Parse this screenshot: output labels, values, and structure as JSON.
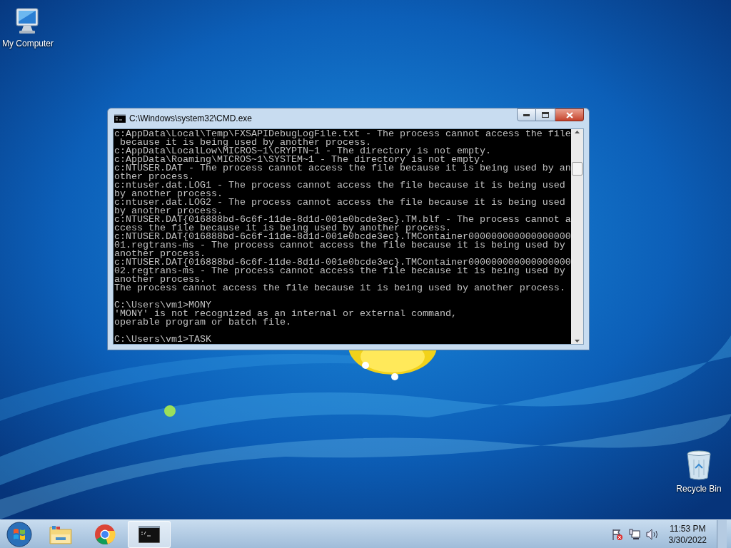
{
  "desktop_icons": [
    {
      "kind": "computer",
      "label": "My Computer"
    },
    {
      "kind": "recycle",
      "label": "Recycle Bin"
    }
  ],
  "window": {
    "title": "C:\\Windows\\system32\\CMD.exe",
    "console_blocks": [
      [
        "c:AppData\\Local\\Temp\\FXSAPIDebugLogFile.txt - The process cannot access the file",
        " because it is being used by another process.",
        "c:AppData\\LocalLow\\MICROS~1\\CRYPTN~1 - The directory is not empty.",
        "c:AppData\\Roaming\\MICROS~1\\SYSTEM~1 - The directory is not empty.",
        "c:NTUSER.DAT - The process cannot access the file because it is being used by an",
        "other process.",
        "c:ntuser.dat.LOG1 - The process cannot access the file because it is being used",
        "by another process.",
        "c:ntuser.dat.LOG2 - The process cannot access the file because it is being used",
        "by another process.",
        "c:NTUSER.DAT{016888bd-6c6f-11de-8d1d-001e0bcde3ec}.TM.blf - The process cannot a",
        "ccess the file because it is being used by another process.",
        "c:NTUSER.DAT{016888bd-6c6f-11de-8d1d-001e0bcde3ec}.TMContainer000000000000000000",
        "01.regtrans-ms - The process cannot access the file because it is being used by",
        "another process.",
        "c:NTUSER.DAT{016888bd-6c6f-11de-8d1d-001e0bcde3ec}.TMContainer000000000000000000",
        "02.regtrans-ms - The process cannot access the file because it is being used by",
        "another process.",
        "The process cannot access the file because it is being used by another process."
      ],
      [
        "C:\\Users\\vm1>MONY",
        "'MONY' is not recognized as an internal or external command,",
        "operable program or batch file."
      ],
      [
        "C:\\Users\\vm1>TASK"
      ]
    ]
  },
  "taskbar": {
    "items": [
      {
        "kind": "start",
        "selected": false
      },
      {
        "kind": "explorer",
        "selected": false
      },
      {
        "kind": "chrome",
        "selected": false
      },
      {
        "kind": "cmd",
        "selected": true
      }
    ],
    "tray": {
      "time": "11:53 PM",
      "date": "3/30/2022"
    }
  }
}
